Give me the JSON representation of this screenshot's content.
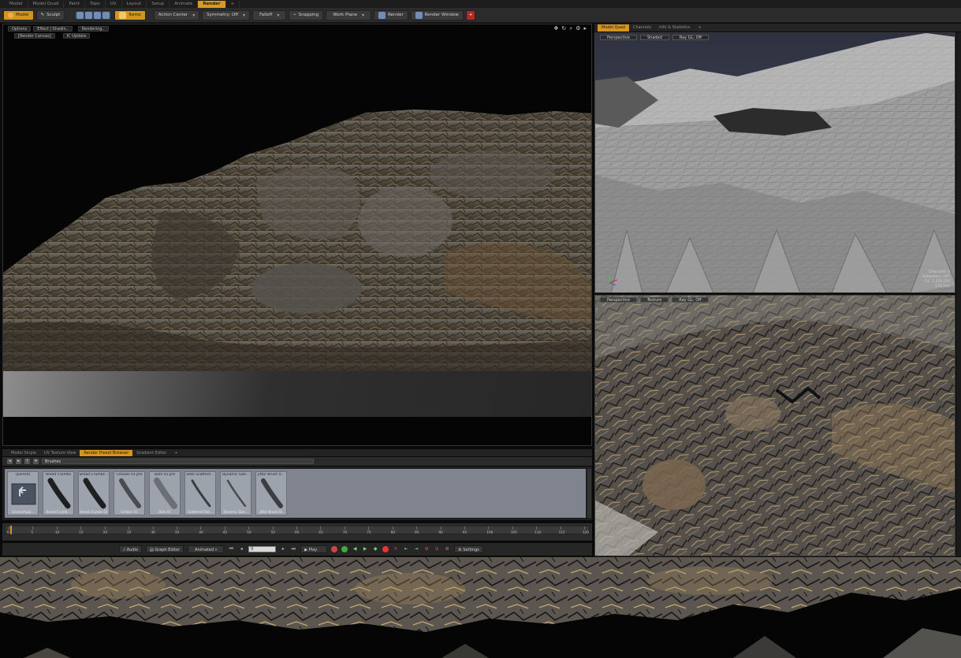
{
  "menu_tabs": [
    "Model",
    "Model Quad",
    "Paint",
    "Topo",
    "UV",
    "Layout",
    "Setup",
    "Animate",
    "Render",
    "+"
  ],
  "toolbar": {
    "model_label": "Model",
    "sculpt_label": "Sculpt",
    "items_label": "Items",
    "action_center_label": "Action Center",
    "symmetry_label": "Symmetry: Off",
    "falloff_label": "Falloff",
    "snapping_label": "Snapping",
    "work_plane_label": "Work Plane",
    "render_label": "Render",
    "render_window_label": "Render Window",
    "add_label": "+"
  },
  "render_viewport": {
    "options_label": "Options",
    "effect_label": "Effect | Shadin..",
    "rendering_label": "Rendering..",
    "render_canvas_label": "[Render Canvas]",
    "ic_update_label": "IC Update"
  },
  "quad_tabs": [
    "Model Quad",
    "Channels",
    "Info & Statistics",
    "+"
  ],
  "quad_top": {
    "view_label": "Perspective",
    "shading_label": "Shaded",
    "gl_label": "Ray GL: Off",
    "stats": [
      "Channels: 0",
      "Deformers: OFF",
      "GL: 1,339,150",
      "170 mm"
    ]
  },
  "quad_bottom": {
    "view_label": "Perspective",
    "shading_label": "Texture",
    "gl_label": "Ray GL: Off"
  },
  "panel_tabs": [
    "Model Single",
    "UV Texture View",
    "Render Preset Browser",
    "Gradient Editor",
    "+"
  ],
  "browser": {
    "path_value": "Brushes",
    "presets": [
      {
        "name": "(parent)",
        "sub": "Library/Appl..."
      },
      {
        "name": "Bread Crumbs",
        "sub": "Bread Crumb..."
      },
      {
        "name": "Bread Crumbs...",
        "sub": "Bread Crumbs 02"
      },
      {
        "name": "Cellular 01.pre",
        "sub": "Cellular 01"
      },
      {
        "name": "Dots 01.pre",
        "sub": "Dots 01"
      },
      {
        "name": "Dots Scattere...",
        "sub": "Scattered Dot..."
      },
      {
        "name": "Dynamic Size...",
        "sub": "Dynamic Size..."
      },
      {
        "name": "Jitter Brush 0...",
        "sub": "Jitter Brush 01"
      }
    ]
  },
  "timeline": {
    "ticks": [
      "0",
      "5",
      "10",
      "15",
      "20",
      "25",
      "30",
      "35",
      "40",
      "45",
      "50",
      "55",
      "60",
      "65",
      "70",
      "75",
      "80",
      "85",
      "90",
      "95",
      "100",
      "105",
      "110",
      "115",
      "120"
    ],
    "current_frame": "0"
  },
  "transport": {
    "audio_label": "Audio",
    "graph_editor_label": "Graph Editor",
    "animated_label": "Animated",
    "play_label": "Play",
    "settings_label": "Settings"
  },
  "colors": {
    "accent": "#d4951e",
    "panel_bg": "#2b2b2b",
    "viewport_bg": "#050505"
  }
}
